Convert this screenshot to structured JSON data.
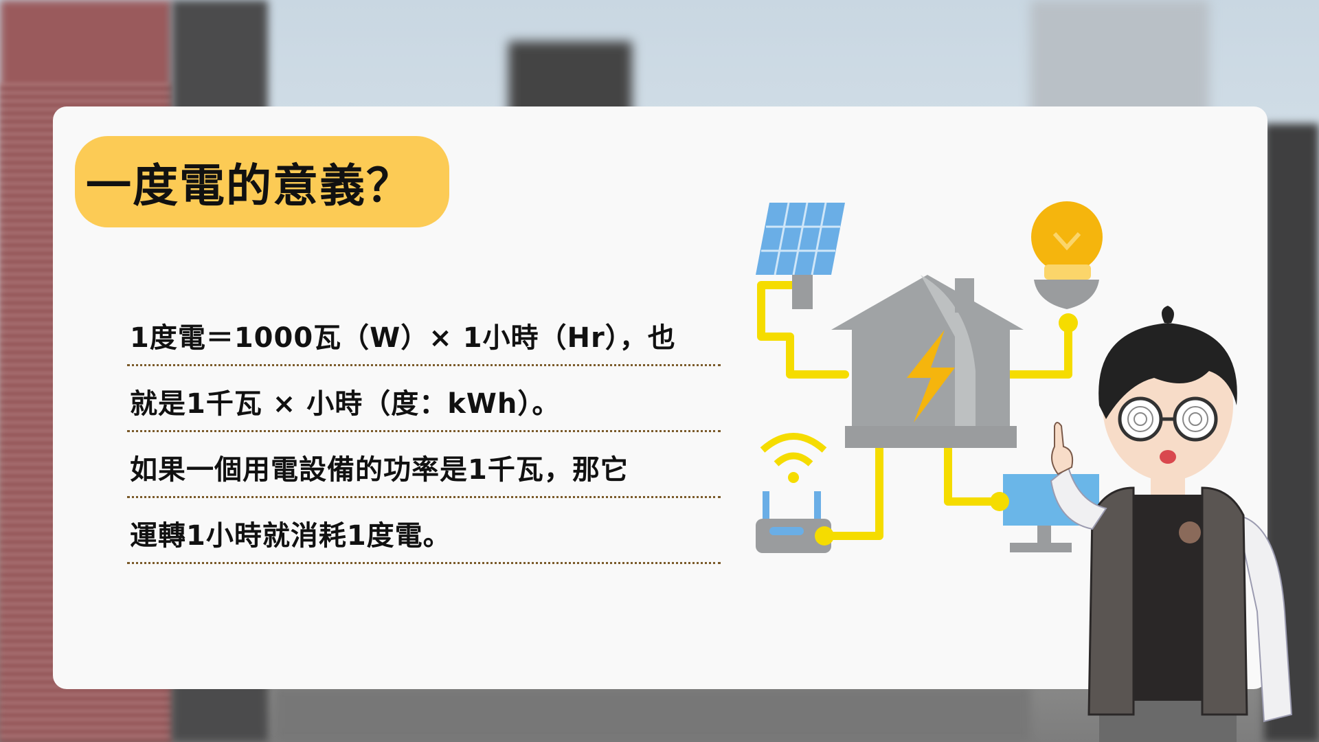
{
  "slide": {
    "title": "一度電的意義？",
    "lines": [
      "1度電＝1000瓦（W）× 1小時（Hr），也",
      "就是1千瓦 × 小時（度：kWh）。",
      "如果一個用電設備的功率是1千瓦，那它",
      "運轉1小時就消耗1度電。"
    ]
  },
  "colors": {
    "title_pill": "#fccb55",
    "card": "#f9f9f9",
    "wire": "#f5dc00",
    "house": "#a0a3a5",
    "bolt": "#f5b50d",
    "solar_panel": "#6aaee6",
    "bulb": "#f5b50d",
    "monitor": "#6ab6e8",
    "vest": "#5a5552"
  },
  "icons": {
    "illustration": "smart-home-energy-illustration",
    "character": "cartoon-boy-pointing-illustration"
  }
}
